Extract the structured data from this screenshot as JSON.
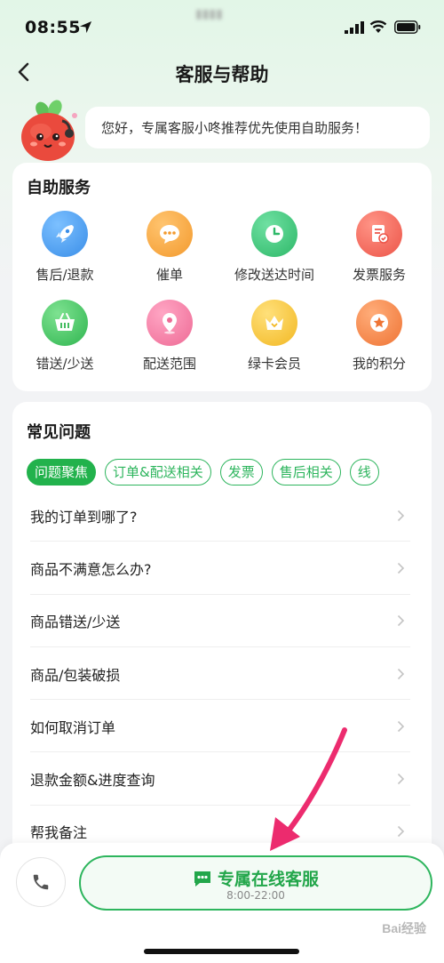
{
  "status_bar": {
    "time": "08:55"
  },
  "nav": {
    "title": "客服与帮助"
  },
  "greeting": {
    "text": "您好，专属客服小咚推荐优先使用自助服务！"
  },
  "self_service": {
    "title": "自助服务",
    "items": [
      {
        "label": "售后/退款",
        "icon": "rocket-icon",
        "color": "#4aa3f0"
      },
      {
        "label": "催单",
        "icon": "chat-dots-icon",
        "color": "#f6a843"
      },
      {
        "label": "修改送达时间",
        "icon": "clock-icon",
        "color": "#3cc37a"
      },
      {
        "label": "发票服务",
        "icon": "invoice-icon",
        "color": "#f06a5e"
      },
      {
        "label": "错送/少送",
        "icon": "basket-icon",
        "color": "#3fc466"
      },
      {
        "label": "配送范围",
        "icon": "location-pin-icon",
        "color": "#f27aa2"
      },
      {
        "label": "绿卡会员",
        "icon": "crown-icon",
        "color": "#f5c43c"
      },
      {
        "label": "我的积分",
        "icon": "star-badge-icon",
        "color": "#f3864a"
      }
    ]
  },
  "faq": {
    "title": "常见问题",
    "tabs": [
      {
        "label": "问题聚焦",
        "active": true
      },
      {
        "label": "订单&配送相关",
        "active": false
      },
      {
        "label": "发票",
        "active": false
      },
      {
        "label": "售后相关",
        "active": false
      },
      {
        "label": "线",
        "active": false
      }
    ],
    "questions": [
      "我的订单到哪了?",
      "商品不满意怎么办?",
      "商品错送/少送",
      "商品/包装破损",
      "如何取消订单",
      "退款金额&进度查询",
      "帮我备注"
    ]
  },
  "bottom": {
    "cs_label": "专属在线客服",
    "cs_hours": "8:00-22:00"
  },
  "watermark": "Bai经验"
}
